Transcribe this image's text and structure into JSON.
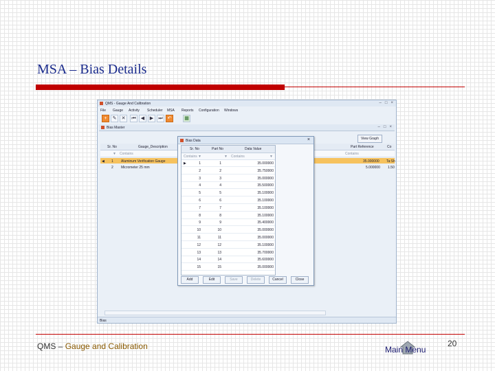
{
  "slide": {
    "title": "MSA – Bias Details",
    "footer_left_prefix": "QMS – ",
    "footer_left_accent": "Gauge and Calibration",
    "main_menu_label": "Main Menu",
    "page_number": "20"
  },
  "app": {
    "window_title": "QMS - Gauge And Calibration",
    "menu": [
      "File",
      "Gauge",
      "Activity",
      "Scheduler",
      "MSA",
      "Reports",
      "Configuration",
      "Windows"
    ],
    "toolbar_icons": [
      "new-icon",
      "edit-icon",
      "delete-icon",
      "first-icon",
      "prev-icon",
      "next-icon",
      "last-icon",
      "undo-icon",
      "calendar-icon"
    ],
    "child_title": "Bias Master",
    "view_graph_label": "View Graph",
    "status_text": "Bias",
    "columns": [
      "Sr. No",
      "Gauge_Description",
      "Part Reference",
      "Co"
    ],
    "filter_placeholder": "Contains",
    "rows": [
      {
        "sr": "1",
        "desc": "Aluminum Verification Gauge",
        "ref": "35.000000",
        "co": "Ta:Sh"
      },
      {
        "sr": "2",
        "desc": "Micrometer 25 mm",
        "ref": "5.000000",
        "co": "1.50"
      }
    ]
  },
  "dialog": {
    "title": "Bias Data",
    "columns": [
      "Sr. No",
      "Part No",
      "Data Value"
    ],
    "filter_placeholder": "Contains",
    "rows": [
      {
        "sr": "1",
        "part": "1",
        "value": "35.000000"
      },
      {
        "sr": "2",
        "part": "2",
        "value": "35.750000"
      },
      {
        "sr": "3",
        "part": "3",
        "value": "35.000000"
      },
      {
        "sr": "4",
        "part": "4",
        "value": "35.500000"
      },
      {
        "sr": "5",
        "part": "5",
        "value": "35.100000"
      },
      {
        "sr": "6",
        "part": "6",
        "value": "35.100000"
      },
      {
        "sr": "7",
        "part": "7",
        "value": "35.100000"
      },
      {
        "sr": "8",
        "part": "8",
        "value": "35.100000"
      },
      {
        "sr": "9",
        "part": "9",
        "value": "35.400000"
      },
      {
        "sr": "10",
        "part": "10",
        "value": "35.000000"
      },
      {
        "sr": "11",
        "part": "11",
        "value": "35.000000"
      },
      {
        "sr": "12",
        "part": "12",
        "value": "35.100000"
      },
      {
        "sr": "13",
        "part": "13",
        "value": "35.700000"
      },
      {
        "sr": "14",
        "part": "14",
        "value": "35.600000"
      },
      {
        "sr": "15",
        "part": "15",
        "value": "35.000000"
      }
    ],
    "buttons": [
      "Add",
      "Edit",
      "Save",
      "Delete",
      "Cancel",
      "Close"
    ]
  },
  "colors": {
    "title": "#1a2b8c",
    "accent_red": "#c00000",
    "selected_row": "#f6c25e"
  }
}
